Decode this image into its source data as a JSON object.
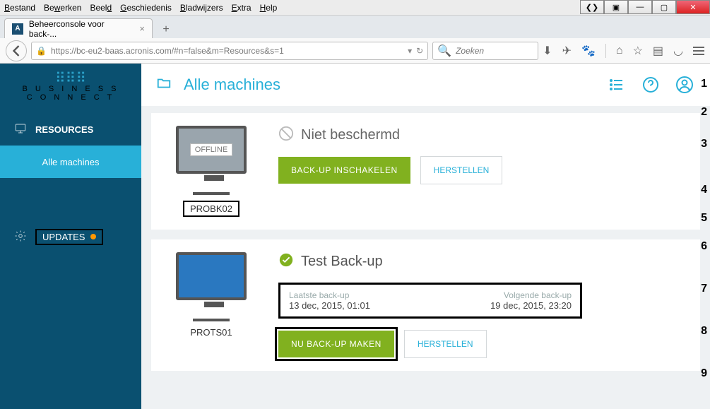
{
  "window": {
    "menubar": [
      "Bestand",
      "Bewerken",
      "Beeld",
      "Geschiedenis",
      "Bladwijzers",
      "Extra",
      "Help"
    ]
  },
  "tab": {
    "title": "Beheerconsole voor back-...",
    "favicon_letter": "A"
  },
  "toolbar": {
    "url": "https://bc-eu2-baas.acronis.com/#n=false&m=Resources&s=1",
    "search_placeholder": "Zoeken"
  },
  "sidebar": {
    "logo_line1": "B U S I N E S S",
    "logo_line2": "C O N N E C T",
    "resources_label": "RESOURCES",
    "all_machines_label": "Alle machines",
    "updates_label": "UPDATES"
  },
  "header": {
    "title": "Alle machines"
  },
  "machines": [
    {
      "name": "PROBK02",
      "offline_label": "OFFLINE",
      "online": false,
      "status_title": "Niet beschermd",
      "status_ok": false,
      "primary_btn": "BACK-UP INSCHAKELEN",
      "secondary_btn": "HERSTELLEN"
    },
    {
      "name": "PROTS01",
      "online": true,
      "status_title": "Test Back-up",
      "status_ok": true,
      "last_label": "Laatste back-up",
      "last_value": "13 dec, 2015, 01:01",
      "next_label": "Volgende back-up",
      "next_value": "19 dec, 2015, 23:20",
      "primary_btn": "NU BACK-UP MAKEN",
      "secondary_btn": "HERSTELLEN"
    }
  ],
  "annotations": [
    "1",
    "2",
    "3",
    "4",
    "5",
    "6",
    "7",
    "8",
    "9"
  ]
}
